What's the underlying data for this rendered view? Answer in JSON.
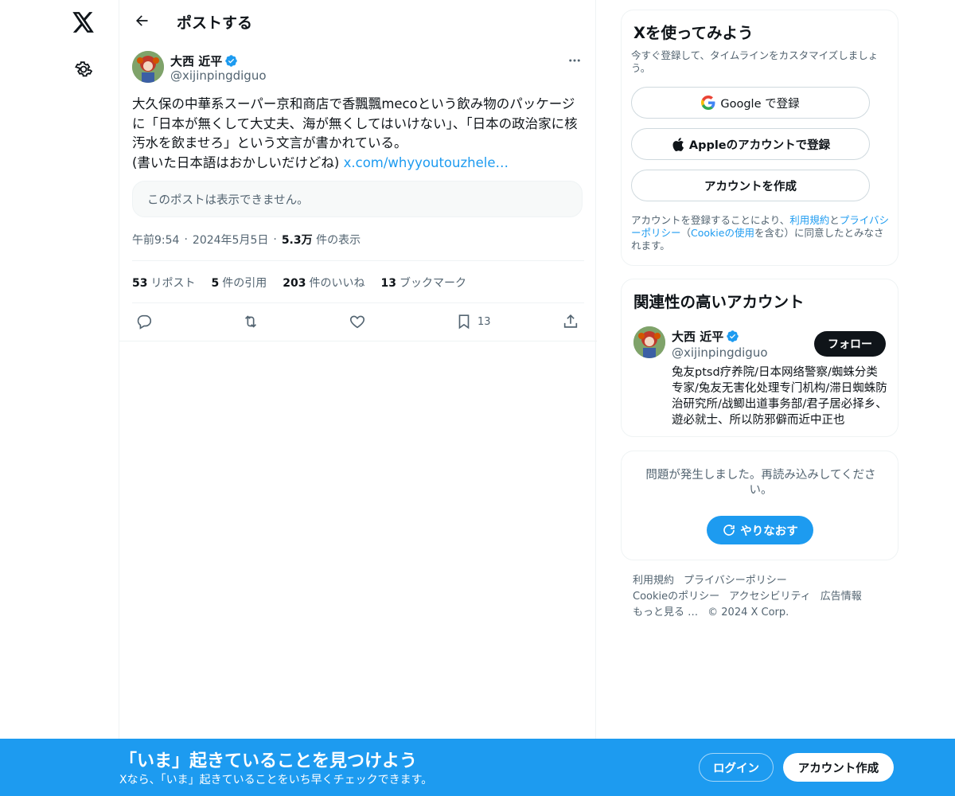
{
  "header": {
    "title": "ポストする"
  },
  "post": {
    "author_name": "大西 近平",
    "author_handle": "@xijinpingdiguo",
    "text": "大久保の中華系スーパー京和商店で香飄飄mecoという飲み物のパッケージに「日本が無くして大丈夫、海が無くしてはいけない」、「日本の政治家に核汚水を飲ませろ」という文言が書かれている。\n(書いた日本語はおかしいだけどね) ",
    "link": "x.com/whyyoutouzhele…",
    "unavailable": "このポストは表示できません。",
    "time": "午前9:54",
    "date": "2024年5月5日",
    "views_value": "5.3万",
    "views_label": "件の表示",
    "sep": "·"
  },
  "stats": [
    {
      "value": "53",
      "label": "リポスト"
    },
    {
      "value": "5",
      "label": "件の引用"
    },
    {
      "value": "203",
      "label": "件のいいね"
    },
    {
      "value": "13",
      "label": "ブックマーク"
    }
  ],
  "actions": {
    "bookmark_count": "13"
  },
  "signup": {
    "title": "Xを使ってみよう",
    "subtitle": "今すぐ登録して、タイムラインをカスタマイズしましょう。",
    "google_label": "Google で登録",
    "apple_label": "Appleのアカウントで登録",
    "create_label": "アカウントを作成",
    "legal_1": "アカウントを登録することにより、",
    "legal_terms": "利用規約",
    "legal_and": "と",
    "legal_privacy": "プライバシーポリシー",
    "legal_2": "（",
    "legal_cookie": "Cookieの使用",
    "legal_3": "を含む）に同意したとみなされます。"
  },
  "related": {
    "title": "関連性の高いアカウント",
    "name": "大西 近平",
    "handle": "@xijinpingdiguo",
    "follow_label": "フォロー",
    "bio": "兔友ptsd疗养院/日本网络警察/蜘蛛分类专家/兔友无害化处理专门机构/滞日蜘蛛防治研究所/战鲫出道事务部/君子居必择乡、遊必就士、所以防邪僻而近中正也"
  },
  "error": {
    "message": "問題が発生しました。再読み込みしてください。",
    "retry_label": "やりなおす"
  },
  "footer": {
    "terms": "利用規約",
    "privacy": "プライバシーポリシー",
    "cookie": "Cookieのポリシー",
    "accessibility": "アクセシビリティ",
    "ads": "広告情報",
    "more": "もっと見る …",
    "copyright": "© 2024 X Corp."
  },
  "bottom_bar": {
    "title": "「いま」起きていることを見つけよう",
    "subtitle": "Xなら、「いま」起きていることをいち早くチェックできます。",
    "login_label": "ログイン",
    "signup_label": "アカウント作成"
  },
  "colors": {
    "accent": "#1d9bf0",
    "text": "#0f1419",
    "secondary": "#536471",
    "border": "#eff3f4"
  },
  "icons": [
    "x-logo-icon",
    "settings-gear-icon",
    "back-arrow-icon",
    "verified-badge-icon",
    "more-dots-icon",
    "reply-icon",
    "repost-icon",
    "like-heart-icon",
    "bookmark-icon",
    "share-icon",
    "google-icon",
    "apple-icon",
    "refresh-icon"
  ]
}
